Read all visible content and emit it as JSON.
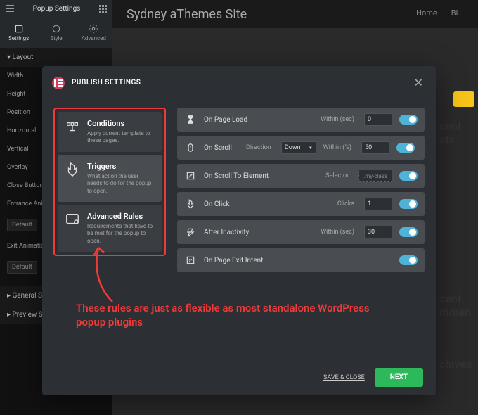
{
  "site": {
    "title": "Sydney aThemes Site",
    "nav": {
      "home": "Home",
      "blog": "Bl..."
    },
    "sidebar_widgets": {
      "recent_posts": "cent sts",
      "recent_comments": "cent mmen",
      "archives": "chives"
    }
  },
  "panel": {
    "title": "Popup Settings",
    "tabs": {
      "settings": "Settings",
      "style": "Style",
      "advanced": "Advanced"
    },
    "section_layout": "Layout",
    "width_label": "Width",
    "height_label": "Height",
    "position_label": "Position",
    "horizontal_label": "Horizontal",
    "vertical_label": "Vertical",
    "overlay_label": "Overlay",
    "close_button_label": "Close Button",
    "entrance_anim_label": "Entrance Anim...",
    "exit_anim_label": "Exit Animation",
    "default_option": "Default",
    "general_section": "General Se...",
    "preview_section": "Preview Se..."
  },
  "modal": {
    "title": "PUBLISH SETTINGS",
    "cards": {
      "conditions": {
        "title": "Conditions",
        "desc": "Apply current template to these pages."
      },
      "triggers": {
        "title": "Triggers",
        "desc": "What action the user needs to do for the popup to open."
      },
      "advanced": {
        "title": "Advanced Rules",
        "desc": "Requirements that have to be met for the popup to open."
      }
    },
    "triggers": {
      "page_load": {
        "label": "On Page Load",
        "param_label": "Within (sec)",
        "value": "0"
      },
      "scroll": {
        "label": "On Scroll",
        "dir_label": "Direction",
        "dir_value": "Down",
        "param_label": "Within (%)",
        "value": "50"
      },
      "scroll_el": {
        "label": "On Scroll To Element",
        "param_label": "Selector",
        "placeholder": ".my-class"
      },
      "click": {
        "label": "On Click",
        "param_label": "Clicks",
        "value": "1"
      },
      "inactivity": {
        "label": "After Inactivity",
        "param_label": "Within (sec)",
        "value": "30"
      },
      "exit": {
        "label": "On Page Exit Intent"
      }
    },
    "footer": {
      "save_close": "SAVE & CLOSE",
      "next": "NEXT"
    }
  },
  "annotation": "These rules are just as flexible as most standalone WordPress popup plugins"
}
